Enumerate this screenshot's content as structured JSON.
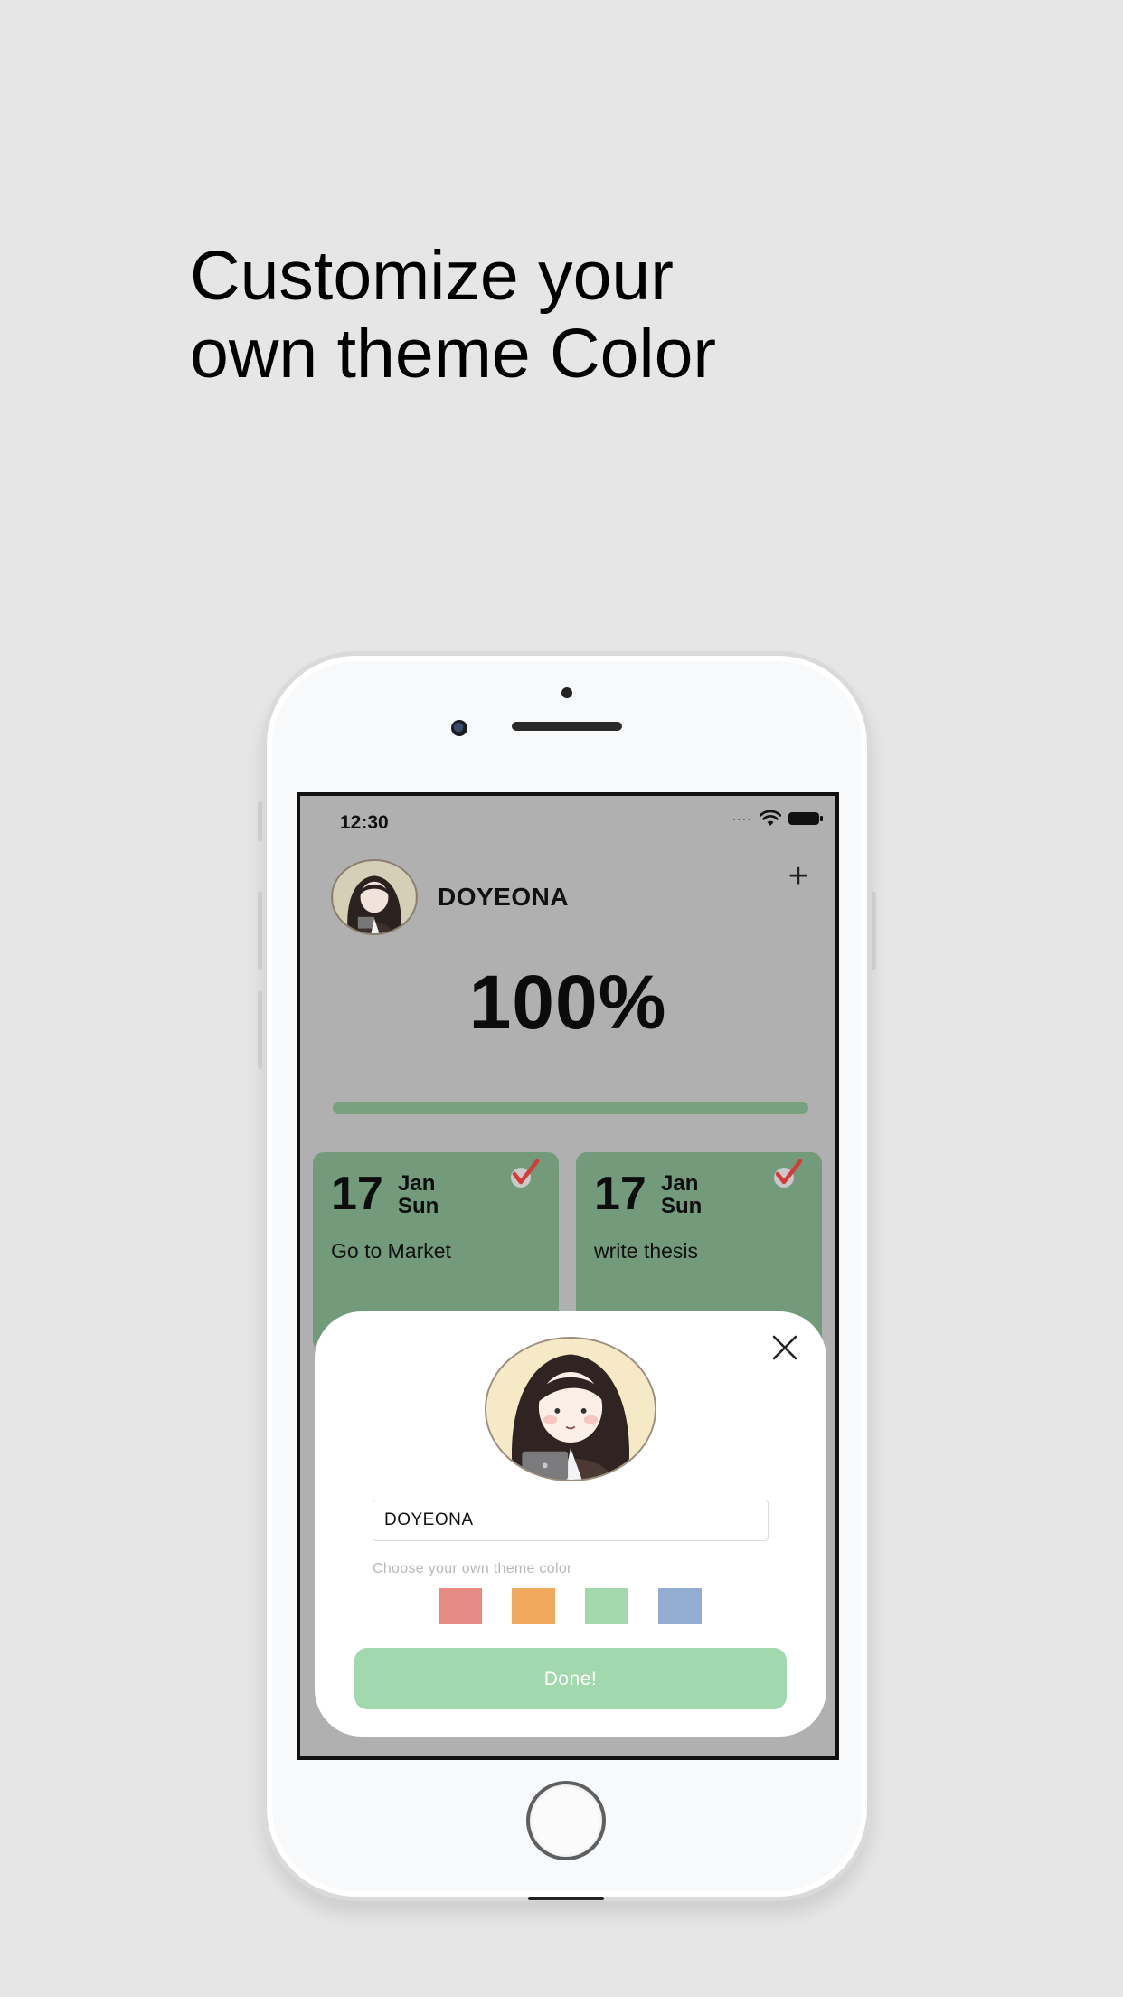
{
  "headline": {
    "line1": "Customize your",
    "line2": "own theme Color"
  },
  "status_bar": {
    "time": "12:30",
    "signal_dots": "····"
  },
  "header": {
    "username": "DOYEONA",
    "add_label": "+"
  },
  "progress": {
    "percent_label": "100%",
    "value": 1.0,
    "fill_color": "#77a07e"
  },
  "cards": [
    {
      "day": "17",
      "month": "Jan",
      "weekday": "Sun",
      "task": "Go to Market",
      "done": true
    },
    {
      "day": "17",
      "month": "Jan",
      "weekday": "Sun",
      "task": "write thesis",
      "done": true
    }
  ],
  "modal": {
    "name_value": "DOYEONA",
    "hint": "Choose your own theme color",
    "swatches": [
      "#e58a84",
      "#f1a95e",
      "#a2d8ab",
      "#93aed1"
    ],
    "done_label": "Done!",
    "done_color": "#a1d8ae"
  },
  "colors": {
    "background": "#e5e6e5",
    "screen_background": "#b0b0b0",
    "card_color": "#739a7b",
    "check_color": "#d43a3a"
  }
}
